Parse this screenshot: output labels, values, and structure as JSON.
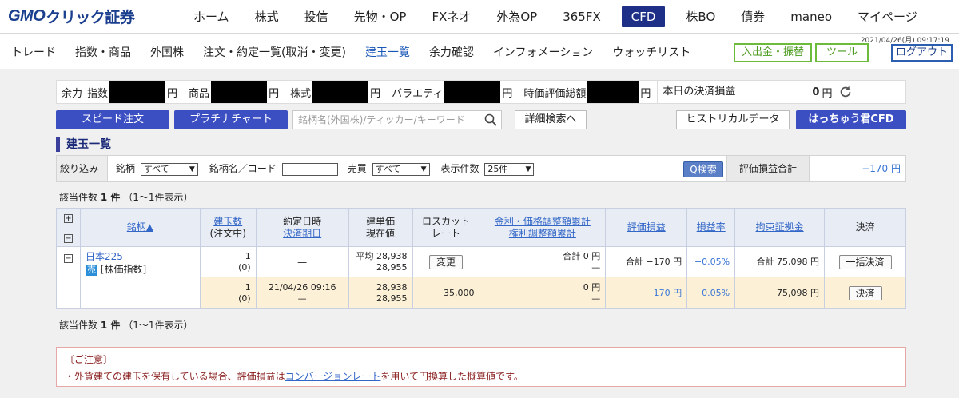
{
  "brand": {
    "logo_latin": "GMO",
    "logo_jp": "クリック証券"
  },
  "nav": {
    "items": [
      "ホーム",
      "株式",
      "投信",
      "先物・OP",
      "FXネオ",
      "外為OP",
      "365FX",
      "CFD",
      "株BO",
      "債券",
      "maneo",
      "マイページ"
    ],
    "active": "CFD"
  },
  "datetime": "2021/04/26(月) 09:17:19",
  "subnav": {
    "items": [
      "トレード",
      "指数・商品",
      "外国株",
      "注文・約定一覧(取消・変更)",
      "建玉一覧",
      "余力確認",
      "インフォメーション",
      "ウォッチリスト"
    ],
    "active": "建玉一覧",
    "deposit_label": "入出金・振替",
    "tool_label": "ツール",
    "logout_label": "ログアウト"
  },
  "balance": {
    "prefix": "余力",
    "index_label": "指数",
    "commodity_label": "商品",
    "stock_label": "株式",
    "variety_label": "バラエティ",
    "market_value_label": "時価評価総額",
    "unit": "円",
    "today_label": "本日の決済損益",
    "today_value": "0",
    "today_unit": "円"
  },
  "actions": {
    "speed_order": "スピード注文",
    "platinum_chart": "プラチナチャート",
    "search_placeholder": "銘柄名(外国株)/ティッカー/キーワード",
    "detail_search": "詳細検索へ",
    "historical": "ヒストリカルデータ",
    "hacchu": "はっちゅう君CFD"
  },
  "section_title": "建玉一覧",
  "filter": {
    "label": "絞り込み",
    "brand_label": "銘柄",
    "brand_value": "すべて",
    "name_label": "銘柄名／コード",
    "side_label": "売買",
    "side_value": "すべて",
    "count_label": "表示件数",
    "count_value": "25件",
    "search_button": "検索",
    "eval_total_label": "評価損益合計",
    "eval_total_value": "−170 円"
  },
  "result_top": {
    "label": "該当件数",
    "count": "1 件",
    "range": "（1〜1件表示）"
  },
  "result_bottom": {
    "label": "該当件数",
    "count": "1 件",
    "range": "（1〜1件表示）"
  },
  "table": {
    "h_symbol": "銘柄▲",
    "h_qty1": "建玉数",
    "h_qty2": "(注文中)",
    "h_date1": "約定日時",
    "h_date2": "決済期日",
    "h_price1": "建単価",
    "h_price2": "現在値",
    "h_loss1": "ロスカット",
    "h_loss2": "レート",
    "h_int1": "金利・価格調整額累計",
    "h_int2": "権利調整額累計",
    "h_eval": "評価損益",
    "h_rate": "損益率",
    "h_margin": "拘束証拠金",
    "h_settle": "決済",
    "row1": {
      "symbol": "日本225",
      "side": "売",
      "category": "[株価指数]",
      "qty": "1",
      "qty_pending": "(0)",
      "date": "—",
      "avg_label": "平均 28,938",
      "current": "28,955",
      "change_btn": "変更",
      "int_total": "合計 0 円",
      "rights": "—",
      "eval": "合計 −170 円",
      "rate": "−0.05%",
      "margin": "合計 75,098 円",
      "settle_btn": "一括決済"
    },
    "row2": {
      "qty": "1",
      "qty_pending": "(0)",
      "date1": "21/04/26 09:16",
      "date2": "—",
      "price": "28,938",
      "current": "28,955",
      "loss_rate": "35,000",
      "int_total": "0 円",
      "rights": "—",
      "eval": "−170 円",
      "rate": "−0.05%",
      "margin": "75,098 円",
      "settle_btn": "決済"
    }
  },
  "notice": {
    "title": "〔ご注意〕",
    "pre": "・外貨建ての建玉を保有している場合、評価損益は",
    "link": "コンバージョンレート",
    "post": "を用いて円換算した概算値です。"
  }
}
